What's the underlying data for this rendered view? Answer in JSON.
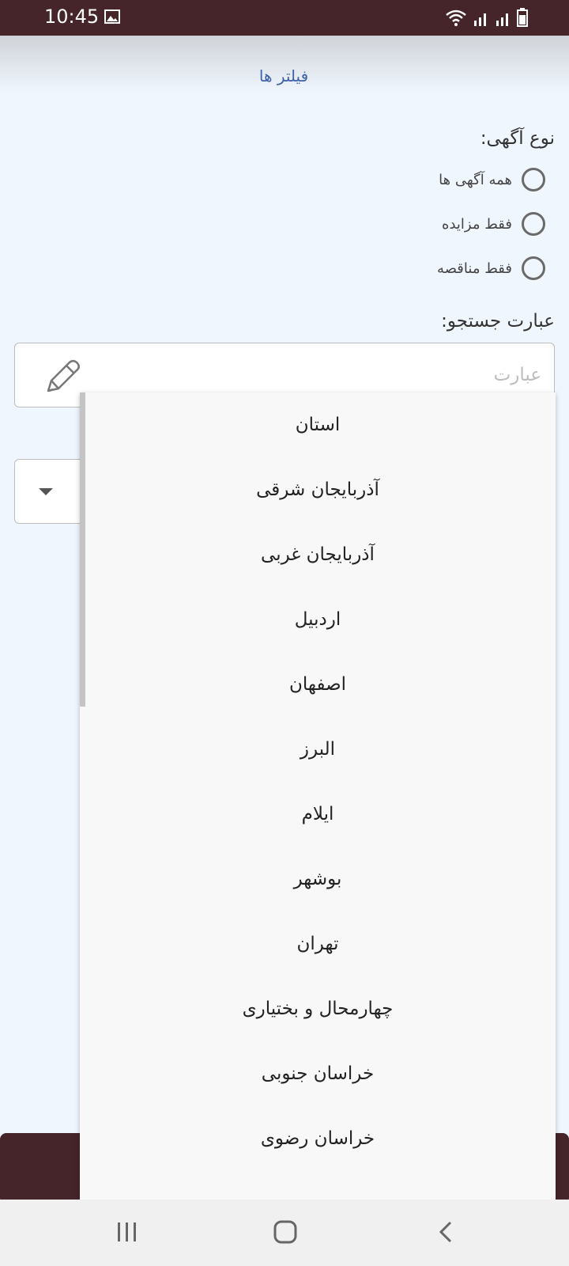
{
  "status_bar": {
    "time": "10:45",
    "icons": [
      "image-icon",
      "wifi-icon",
      "signal-icon",
      "signal-icon",
      "battery-icon"
    ]
  },
  "header": {
    "title": "فیلتر ها"
  },
  "ad_type": {
    "label": "نوع آگهی:",
    "options": [
      "همه آگهی ها",
      "فقط مزایده",
      "فقط مناقصه"
    ]
  },
  "search": {
    "label": "عبارت جستجو:",
    "placeholder": "عبارت",
    "value": ""
  },
  "province_dropdown": {
    "items": [
      "استان",
      "آذربایجان شرقی",
      "آذربایجان غربی",
      "اردبیل",
      "اصفهان",
      "البرز",
      "ایلام",
      "بوشهر",
      "تهران",
      "چهارمحال و بختیاری",
      "خراسان جنوبی",
      "خراسان رضوی"
    ]
  },
  "colors": {
    "status_bar": "#45242a",
    "header_title": "#3f63a8",
    "background": "#f0f6fe",
    "bottom_button": "#45242a"
  },
  "nav": {
    "icons": [
      "recent-apps-icon",
      "home-icon",
      "back-icon"
    ]
  }
}
